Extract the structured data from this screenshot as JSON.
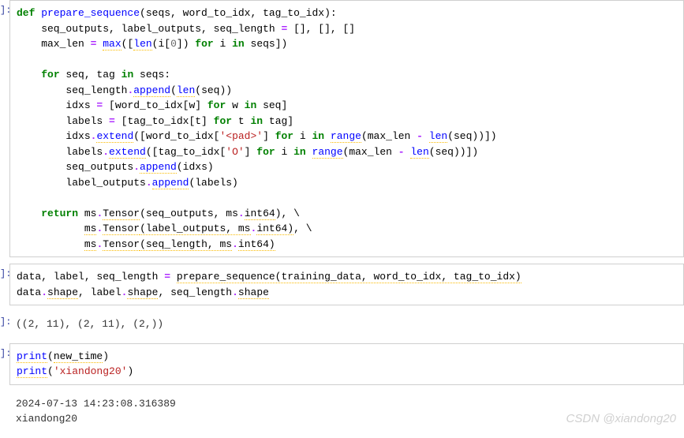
{
  "cells": [
    {
      "type": "code",
      "prompt": "]:",
      "lines": [
        [
          {
            "k": "kw",
            "t": "def"
          },
          {
            "k": "p",
            "t": " "
          },
          {
            "k": "fn",
            "t": "prepare_sequence"
          },
          {
            "k": "p",
            "t": "(seqs, word_to_idx, tag_to_idx):"
          }
        ],
        [
          {
            "k": "p",
            "t": "    seq_outputs, label_outputs, seq_length "
          },
          {
            "k": "op",
            "t": "="
          },
          {
            "k": "p",
            "t": " [], [], []"
          }
        ],
        [
          {
            "k": "p",
            "t": "    max_len "
          },
          {
            "k": "op",
            "t": "="
          },
          {
            "k": "p",
            "t": " "
          },
          {
            "k": "fn-dotted",
            "t": "max"
          },
          {
            "k": "p",
            "t": "(["
          },
          {
            "k": "fn-dotted",
            "t": "len"
          },
          {
            "k": "p",
            "t": "(i["
          },
          {
            "k": "num",
            "t": "0"
          },
          {
            "k": "p",
            "t": "]) "
          },
          {
            "k": "kw",
            "t": "for"
          },
          {
            "k": "p",
            "t": " i "
          },
          {
            "k": "kw",
            "t": "in"
          },
          {
            "k": "p",
            "t": " seqs])"
          }
        ],
        [
          {
            "k": "p",
            "t": ""
          }
        ],
        [
          {
            "k": "p",
            "t": "    "
          },
          {
            "k": "kw",
            "t": "for"
          },
          {
            "k": "p",
            "t": " seq, tag "
          },
          {
            "k": "kw",
            "t": "in"
          },
          {
            "k": "p",
            "t": " seqs:"
          }
        ],
        [
          {
            "k": "p",
            "t": "        seq_length"
          },
          {
            "k": "op",
            "t": "."
          },
          {
            "k": "fn-dotted",
            "t": "append"
          },
          {
            "k": "p",
            "t": "("
          },
          {
            "k": "fn-dotted",
            "t": "len"
          },
          {
            "k": "p",
            "t": "(seq))"
          }
        ],
        [
          {
            "k": "p",
            "t": "        idxs "
          },
          {
            "k": "op",
            "t": "="
          },
          {
            "k": "p",
            "t": " [word_to_idx[w] "
          },
          {
            "k": "kw",
            "t": "for"
          },
          {
            "k": "p",
            "t": " w "
          },
          {
            "k": "kw",
            "t": "in"
          },
          {
            "k": "p",
            "t": " seq]"
          }
        ],
        [
          {
            "k": "p",
            "t": "        labels "
          },
          {
            "k": "op",
            "t": "="
          },
          {
            "k": "p",
            "t": " [tag_to_idx[t] "
          },
          {
            "k": "kw",
            "t": "for"
          },
          {
            "k": "p",
            "t": " t "
          },
          {
            "k": "kw",
            "t": "in"
          },
          {
            "k": "p",
            "t": " tag]"
          }
        ],
        [
          {
            "k": "p",
            "t": "        idxs"
          },
          {
            "k": "op",
            "t": "."
          },
          {
            "k": "fn-dotted",
            "t": "extend"
          },
          {
            "k": "p",
            "t": "([word_to_idx["
          },
          {
            "k": "str",
            "t": "'<pad>'"
          },
          {
            "k": "p",
            "t": "] "
          },
          {
            "k": "kw",
            "t": "for"
          },
          {
            "k": "p",
            "t": " i "
          },
          {
            "k": "kw",
            "t": "in"
          },
          {
            "k": "p",
            "t": " "
          },
          {
            "k": "fn-dotted",
            "t": "range"
          },
          {
            "k": "p",
            "t": "(max_len "
          },
          {
            "k": "op",
            "t": "-"
          },
          {
            "k": "p",
            "t": " "
          },
          {
            "k": "fn-dotted",
            "t": "len"
          },
          {
            "k": "p",
            "t": "(seq))])"
          }
        ],
        [
          {
            "k": "p",
            "t": "        labels"
          },
          {
            "k": "op",
            "t": "."
          },
          {
            "k": "fn-dotted",
            "t": "extend"
          },
          {
            "k": "p",
            "t": "([tag_to_idx["
          },
          {
            "k": "str",
            "t": "'O'"
          },
          {
            "k": "p",
            "t": "] "
          },
          {
            "k": "kw",
            "t": "for"
          },
          {
            "k": "p",
            "t": " i "
          },
          {
            "k": "kw",
            "t": "in"
          },
          {
            "k": "p",
            "t": " "
          },
          {
            "k": "fn-dotted",
            "t": "range"
          },
          {
            "k": "p",
            "t": "(max_len "
          },
          {
            "k": "op",
            "t": "-"
          },
          {
            "k": "p",
            "t": " "
          },
          {
            "k": "fn-dotted",
            "t": "len"
          },
          {
            "k": "p",
            "t": "(seq))])"
          }
        ],
        [
          {
            "k": "p",
            "t": "        seq_outputs"
          },
          {
            "k": "op",
            "t": "."
          },
          {
            "k": "fn-dotted",
            "t": "append"
          },
          {
            "k": "p",
            "t": "(idxs)"
          }
        ],
        [
          {
            "k": "p",
            "t": "        label_outputs"
          },
          {
            "k": "op",
            "t": "."
          },
          {
            "k": "fn-dotted",
            "t": "append"
          },
          {
            "k": "p",
            "t": "(labels)"
          }
        ],
        [
          {
            "k": "p",
            "t": ""
          }
        ],
        [
          {
            "k": "p",
            "t": "    "
          },
          {
            "k": "kw",
            "t": "return"
          },
          {
            "k": "p",
            "t": " ms"
          },
          {
            "k": "op",
            "t": "."
          },
          {
            "k": "attr-dotted",
            "t": "Tensor"
          },
          {
            "k": "p",
            "t": "(seq_outputs, ms"
          },
          {
            "k": "op",
            "t": "."
          },
          {
            "k": "attr-dotted",
            "t": "int64"
          },
          {
            "k": "p",
            "t": "), \\"
          }
        ],
        [
          {
            "k": "p",
            "t": "           "
          },
          {
            "k": "attr-dotted",
            "t": "ms"
          },
          {
            "k": "op",
            "t": "."
          },
          {
            "k": "attr-dotted",
            "t": "Tensor"
          },
          {
            "k": "attr-dotted",
            "t": "(label_outputs, ms"
          },
          {
            "k": "op",
            "t": "."
          },
          {
            "k": "attr-dotted",
            "t": "int64)"
          },
          {
            "k": "p",
            "t": ", \\"
          }
        ],
        [
          {
            "k": "p",
            "t": "           "
          },
          {
            "k": "attr-dotted",
            "t": "ms"
          },
          {
            "k": "op",
            "t": "."
          },
          {
            "k": "attr-dotted",
            "t": "Tensor"
          },
          {
            "k": "attr-dotted",
            "t": "(seq_length, ms"
          },
          {
            "k": "op",
            "t": "."
          },
          {
            "k": "attr-dotted",
            "t": "int64)"
          }
        ]
      ]
    },
    {
      "type": "code",
      "prompt": "]:",
      "lines": [
        [
          {
            "k": "p",
            "t": "data, label, seq_length "
          },
          {
            "k": "op",
            "t": "="
          },
          {
            "k": "p",
            "t": " "
          },
          {
            "k": "attr-dotted",
            "t": "prepare_sequence(training_data, word_to_idx, tag_to_idx)"
          }
        ],
        [
          {
            "k": "p",
            "t": "data"
          },
          {
            "k": "op",
            "t": "."
          },
          {
            "k": "attr-dotted",
            "t": "shape"
          },
          {
            "k": "p",
            "t": ", label"
          },
          {
            "k": "op",
            "t": "."
          },
          {
            "k": "attr-dotted",
            "t": "shape"
          },
          {
            "k": "p",
            "t": ", seq_length"
          },
          {
            "k": "op",
            "t": "."
          },
          {
            "k": "attr-dotted",
            "t": "shape"
          }
        ]
      ]
    },
    {
      "type": "output",
      "prompt": "]:",
      "text": "((2, 11), (2, 11), (2,))"
    },
    {
      "type": "code",
      "prompt": "]:",
      "lines": [
        [
          {
            "k": "fn-dotted",
            "t": "print"
          },
          {
            "k": "p",
            "t": "("
          },
          {
            "k": "attr-dotted",
            "t": "new_time"
          },
          {
            "k": "p",
            "t": ")"
          }
        ],
        [
          {
            "k": "fn-dotted",
            "t": "print"
          },
          {
            "k": "p",
            "t": "("
          },
          {
            "k": "str",
            "t": "'xiandong20'"
          },
          {
            "k": "p",
            "t": ")"
          }
        ]
      ]
    },
    {
      "type": "output",
      "prompt": "",
      "text": "2024-07-13 14:23:08.316389\nxiandong20"
    }
  ],
  "watermark": "CSDN @xiandong20"
}
